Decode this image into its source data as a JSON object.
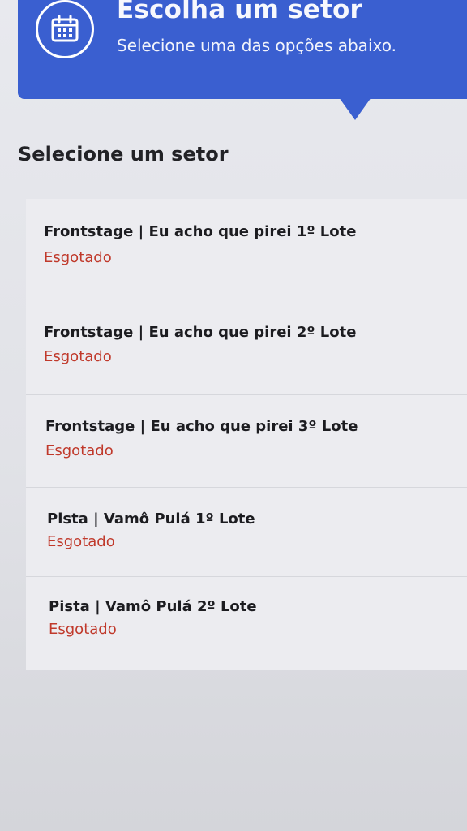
{
  "header": {
    "icon": "calendar-icon",
    "title": "Escolha um setor",
    "subtitle": "Selecione uma das opções abaixo.",
    "accent_color": "#3a5fd0"
  },
  "section": {
    "title": "Selecione um setor"
  },
  "sectors": [
    {
      "name": "Frontstage | Eu acho que pirei 1º Lote",
      "status": "Esgotado"
    },
    {
      "name": "Frontstage | Eu acho que pirei 2º Lote",
      "status": "Esgotado"
    },
    {
      "name": "Frontstage | Eu acho que pirei 3º Lote",
      "status": "Esgotado"
    },
    {
      "name": "Pista | Vamô Pulá 1º Lote",
      "status": "Esgotado"
    },
    {
      "name": "Pista | Vamô Pulá 2º Lote",
      "status": "Esgotado"
    }
  ],
  "status_color": "#c0392b"
}
